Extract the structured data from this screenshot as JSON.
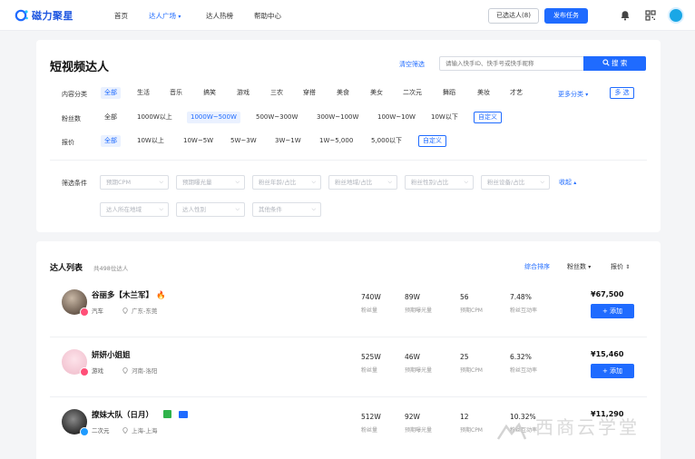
{
  "brand": {
    "name": "磁力聚星",
    "accent": "#1f6bff"
  },
  "nav": {
    "home": "首页",
    "square": "达人广场",
    "hot": "达人热榜",
    "help": "帮助中心",
    "selected_btn": "已选达人(8)",
    "publish_btn": "发布任务",
    "icons": [
      "bell-icon",
      "qr-code-icon",
      "user-avatar"
    ]
  },
  "filter": {
    "title": "短视频达人",
    "clear": "清空筛选",
    "search_placeholder": "请输入快手ID、快手号或快手昵称",
    "search_btn": "搜 索",
    "category_label": "内容分类",
    "categories": [
      "全部",
      "生活",
      "音乐",
      "搞笑",
      "游戏",
      "三农",
      "穿搭",
      "美食",
      "美女",
      "二次元",
      "舞蹈",
      "美妆",
      "才艺"
    ],
    "more_category": "更多分类",
    "multi": "多 选",
    "fans_label": "粉丝数",
    "fans_options": [
      "全部",
      "1000W以上",
      "1000W~500W",
      "500W~300W",
      "300W~100W",
      "100W~10W",
      "10W以下",
      "自定义"
    ],
    "price_label": "报价",
    "price_options": [
      "全部",
      "10W以上",
      "10W~5W",
      "5W~3W",
      "3W~1W",
      "1W~5,000",
      "5,000以下",
      "自定义"
    ],
    "cond_label": "筛选条件",
    "selects_row1": [
      "预期CPM",
      "预期曝光量",
      "粉丝年龄/占比",
      "粉丝地域/占比",
      "粉丝性别/占比",
      "粉丝设备/占比"
    ],
    "selects_row2": [
      "达人所在地域",
      "达人性别",
      "其他条件"
    ],
    "collapse": "收起"
  },
  "list": {
    "title": "达人列表",
    "count": "共498位达人",
    "sort": [
      "综合排序",
      "粉丝数",
      "报价"
    ],
    "add_label": "+ 添加",
    "stat_labels": [
      "粉丝量",
      "预期曝光量",
      "预期CPM",
      "粉丝互动率"
    ],
    "rows": [
      {
        "name": "谷丽多【木兰军】",
        "category": "汽车",
        "location": "广东-东莞",
        "fans": "740W",
        "exposure": "89W",
        "cpm": "56",
        "rate": "7.48%",
        "price": "¥67,500"
      },
      {
        "name": "妍妍小姐姐",
        "category": "游戏",
        "location": "河南-洛阳",
        "fans": "525W",
        "exposure": "46W",
        "cpm": "25",
        "rate": "6.32%",
        "price": "¥15,460"
      },
      {
        "name": "撩妹大队（日月）",
        "category": "二次元",
        "location": "上海-上海",
        "fans": "512W",
        "exposure": "92W",
        "cpm": "12",
        "rate": "10.32%",
        "price": "¥11,290"
      }
    ]
  },
  "watermark": "西商云学堂"
}
